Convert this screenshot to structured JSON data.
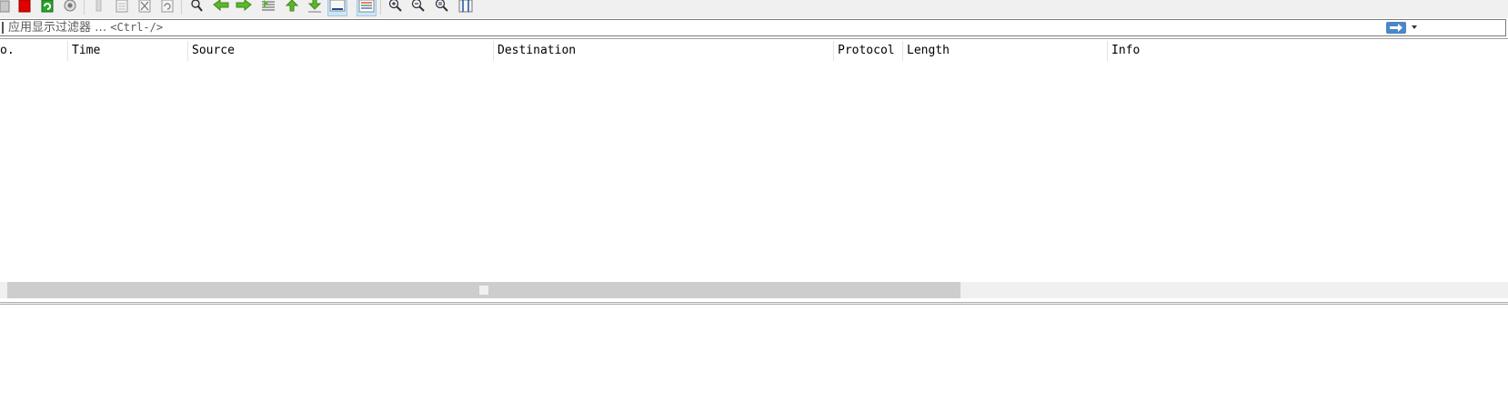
{
  "toolbar": {
    "buttons": [
      {
        "icon": "open-file-icon"
      },
      {
        "icon": "stop-capture-icon",
        "color": "#e00000"
      },
      {
        "icon": "restart-capture-icon",
        "color": "#2aa52a"
      },
      {
        "icon": "capture-options-icon"
      },
      {
        "icon": "open-icon"
      },
      {
        "icon": "save-icon"
      },
      {
        "icon": "close-file-icon"
      },
      {
        "icon": "reload-icon"
      },
      {
        "icon": "find-packet-icon"
      },
      {
        "icon": "go-back-icon",
        "color": "#5cb82a"
      },
      {
        "icon": "go-forward-icon",
        "color": "#5cb82a"
      },
      {
        "icon": "go-to-packet-icon"
      },
      {
        "icon": "go-first-icon",
        "color": "#5cb82a"
      },
      {
        "icon": "go-last-icon",
        "color": "#5cb82a"
      },
      {
        "icon": "auto-scroll-icon"
      },
      {
        "icon": "colorize-icon"
      },
      {
        "icon": "zoom-in-icon"
      },
      {
        "icon": "zoom-out-icon"
      },
      {
        "icon": "normal-size-icon"
      },
      {
        "icon": "resize-columns-icon"
      }
    ]
  },
  "filter": {
    "placeholder_text": "应用显示过滤器 …",
    "shortcut": "<Ctrl-/>",
    "apply_icon": "apply-filter-arrow-icon",
    "dropdown_icon": "filter-history-dropdown-icon"
  },
  "packet_list": {
    "columns": [
      "o.",
      "Time",
      "Source",
      "Destination",
      "Protocol",
      "Length",
      "Info"
    ],
    "rows": []
  },
  "colors": {
    "toolbar_bg": "#f0f0f0",
    "accent_blue": "#4a86c8",
    "stop_red": "#e00000",
    "nav_green": "#5cb82a"
  }
}
